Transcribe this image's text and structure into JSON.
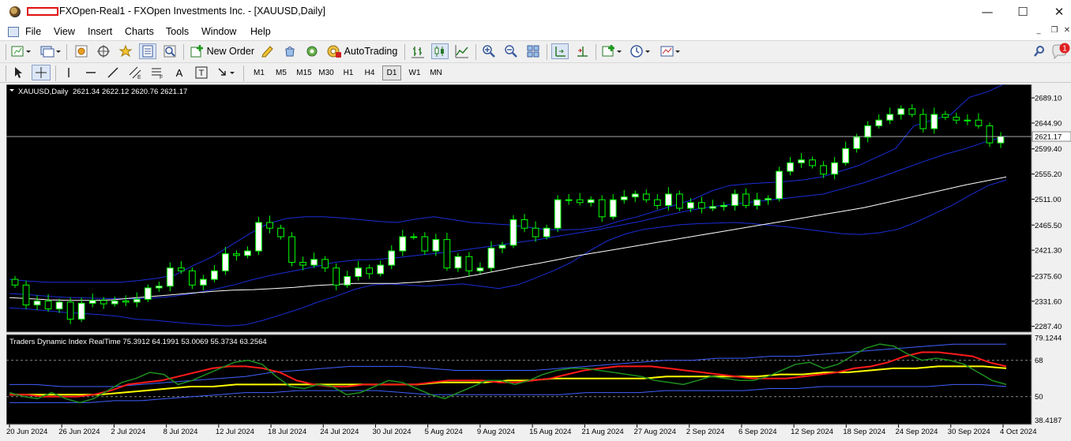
{
  "window": {
    "title": "FXOpen-Real1 - FXOpen Investments Inc. - [XAUUSD,Daily]",
    "minimize": "—",
    "maximize": "☐",
    "close": "✕"
  },
  "menu": {
    "items": [
      "File",
      "View",
      "Insert",
      "Charts",
      "Tools",
      "Window",
      "Help"
    ],
    "mdi_minimize": "_",
    "mdi_restore": "❐",
    "mdi_close": "✕"
  },
  "toolbar": {
    "new_order_label": "New Order",
    "autotrading_label": "AutoTrading",
    "notification_count": "1",
    "timeframes": [
      "M1",
      "M5",
      "M15",
      "M30",
      "H1",
      "H4",
      "D1",
      "W1",
      "MN"
    ],
    "active_timeframe": "D1",
    "text_tool": "A",
    "text_label_tool": "T"
  },
  "icons": {
    "toolbar1": [
      "new-chart-icon",
      "profiles-icon",
      "market-watch-icon",
      "navigator-icon",
      "favorites-icon",
      "data-window-icon",
      "strategy-tester-icon",
      "new-order-icon",
      "metaeditor-icon",
      "mql-market-icon",
      "signals-icon",
      "autotrading-icon",
      "bar-chart-icon",
      "candlesticks-icon",
      "line-chart-icon",
      "zoom-in-icon",
      "zoom-out-icon",
      "tile-windows-icon",
      "chart-shift-icon",
      "autoscroll-icon",
      "indicators-icon",
      "periods-icon",
      "templates-icon",
      "search-icon",
      "notification-icon"
    ],
    "toolbar2": [
      "cursor-icon",
      "crosshair-icon",
      "vertical-line-icon",
      "horizontal-line-icon",
      "trendline-icon",
      "equidistant-channel-icon",
      "fibonacci-icon",
      "text-icon",
      "text-label-icon",
      "arrows-icon"
    ]
  },
  "colors": {
    "chart_bg": "#000000",
    "bull_body": "#ffffff",
    "bear_body": "#000000",
    "wick": "#00ff00",
    "bollinger": "#1a2dd8",
    "ma": "#ffffff",
    "tdi_green": "#1e8e1e",
    "tdi_red": "#ff1a1a",
    "tdi_yellow": "#ffff00",
    "tdi_band": "#4060ff",
    "price_line": "#c0c0c0"
  },
  "chart_data": {
    "type": "candlestick",
    "symbol_label": "XAUUSD,Daily",
    "ohlc_label": "2621.34 2622.12 2620.76 2621.17",
    "current_price_label": "2621.17",
    "price_axis": [
      "2689.10",
      "2644.90",
      "2599.40",
      "2555.20",
      "2511.00",
      "2465.50",
      "2421.30",
      "2375.60",
      "2331.60",
      "2287.40"
    ],
    "ylim": [
      2280,
      2710
    ],
    "date_axis": [
      "20 Jun 2024",
      "26 Jun 2024",
      "2 Jul 2024",
      "8 Jul 2024",
      "12 Jul 2024",
      "18 Jul 2024",
      "24 Jul 2024",
      "30 Jul 2024",
      "5 Aug 2024",
      "9 Aug 2024",
      "15 Aug 2024",
      "21 Aug 2024",
      "27 Aug 2024",
      "2 Sep 2024",
      "6 Sep 2024",
      "12 Sep 2024",
      "18 Sep 2024",
      "24 Sep 2024",
      "30 Sep 2024",
      "4 Oct 2024"
    ],
    "closes": [
      2360,
      2325,
      2332,
      2318,
      2330,
      2300,
      2328,
      2333,
      2327,
      2332,
      2330,
      2335,
      2355,
      2358,
      2390,
      2385,
      2360,
      2370,
      2385,
      2415,
      2412,
      2420,
      2470,
      2460,
      2445,
      2400,
      2395,
      2405,
      2390,
      2360,
      2375,
      2390,
      2380,
      2395,
      2420,
      2445,
      2445,
      2420,
      2440,
      2390,
      2410,
      2385,
      2390,
      2425,
      2430,
      2475,
      2460,
      2445,
      2460,
      2510,
      2510,
      2505,
      2510,
      2480,
      2510,
      2515,
      2520,
      2510,
      2500,
      2520,
      2495,
      2505,
      2495,
      2498,
      2500,
      2520,
      2500,
      2510,
      2512,
      2560,
      2575,
      2580,
      2570,
      2555,
      2575,
      2600,
      2620,
      2640,
      2650,
      2660,
      2670,
      2660,
      2635,
      2660,
      2655,
      2650,
      2650,
      2640,
      2610,
      2621
    ],
    "bollinger_upper": [
      2370,
      2367,
      2365,
      2365,
      2365,
      2365,
      2365,
      2368,
      2372,
      2378,
      2395,
      2410,
      2430,
      2450,
      2468,
      2477,
      2480,
      2480,
      2478,
      2475,
      2472,
      2470,
      2476,
      2480,
      2475,
      2470,
      2468,
      2466,
      2462,
      2458,
      2457,
      2458,
      2462,
      2472,
      2480,
      2490,
      2500,
      2510,
      2525,
      2535,
      2538,
      2540,
      2542,
      2545,
      2550,
      2560,
      2570,
      2585,
      2600,
      2640,
      2650,
      2660,
      2690,
      2700,
      2715
    ],
    "bollinger_mid": [
      2345,
      2343,
      2340,
      2338,
      2337,
      2336,
      2336,
      2337,
      2340,
      2345,
      2352,
      2360,
      2370,
      2378,
      2385,
      2392,
      2400,
      2404,
      2405,
      2408,
      2412,
      2416,
      2420,
      2425,
      2430,
      2435,
      2440,
      2446,
      2452,
      2458,
      2465,
      2472,
      2480,
      2488,
      2495,
      2500,
      2504,
      2508,
      2512,
      2516,
      2520,
      2530,
      2540,
      2552,
      2565,
      2578,
      2590,
      2600,
      2612,
      2622
    ],
    "bollinger_lower": [
      2320,
      2318,
      2315,
      2312,
      2310,
      2308,
      2305,
      2300,
      2298,
      2295,
      2292,
      2290,
      2288,
      2290,
      2298,
      2308,
      2318,
      2330,
      2340,
      2352,
      2360,
      2362,
      2360,
      2358,
      2360,
      2362,
      2358,
      2354,
      2360,
      2372,
      2385,
      2400,
      2420,
      2438,
      2450,
      2458,
      2462,
      2466,
      2468,
      2469,
      2470,
      2468,
      2465,
      2462,
      2458,
      2454,
      2450,
      2449,
      2452,
      2458,
      2470,
      2485,
      2500,
      2518,
      2535,
      2545
    ],
    "moving_average": [
      2338,
      2336,
      2334,
      2333,
      2333,
      2334,
      2337,
      2340,
      2343,
      2346,
      2349,
      2351,
      2352,
      2354,
      2356,
      2359,
      2361,
      2363,
      2363,
      2363,
      2365,
      2368,
      2372,
      2378,
      2385,
      2392,
      2398,
      2405,
      2412,
      2418,
      2424,
      2430,
      2436,
      2442,
      2448,
      2454,
      2460,
      2466,
      2472,
      2478,
      2484,
      2490,
      2496,
      2504,
      2512,
      2520,
      2528,
      2536,
      2543,
      2550
    ],
    "tdi": {
      "label": "Traders Dynamic Index RealTime 75.3912 64.1991 53.0069 55.3734 63.2564",
      "axis": [
        "79.1244",
        "68",
        "50",
        "38.4187"
      ],
      "levels": [
        68,
        50
      ],
      "ylim": [
        37,
        80
      ],
      "green": [
        52,
        50,
        49,
        52,
        49,
        47,
        49,
        53,
        57,
        59,
        62,
        61,
        56,
        58,
        61,
        64,
        67,
        68,
        66,
        60,
        55,
        54,
        56,
        55,
        51,
        52,
        55,
        58,
        57,
        54,
        51,
        49,
        52,
        55,
        58,
        58,
        56,
        58,
        61,
        63,
        64,
        64,
        63,
        62,
        61,
        60,
        58,
        57,
        56,
        58,
        60,
        59,
        58,
        58,
        60,
        63,
        66,
        67,
        64,
        66,
        70,
        74,
        76,
        75,
        71,
        68,
        69,
        68,
        66,
        62,
        58,
        56
      ],
      "red": [
        51,
        51,
        50,
        50,
        50,
        51,
        53,
        56,
        57,
        58,
        60,
        62,
        64,
        65,
        65,
        64,
        62,
        58,
        56,
        55,
        55,
        56,
        56,
        56,
        56,
        57,
        58,
        58,
        58,
        57,
        57,
        58,
        59,
        61,
        63,
        64,
        65,
        65,
        65,
        64,
        63,
        62,
        61,
        60,
        59,
        59,
        59,
        60,
        61,
        62,
        64,
        65,
        67,
        70,
        72,
        72,
        71,
        70,
        67,
        65
      ],
      "yellow": [
        51,
        51,
        51,
        51,
        51,
        52,
        53,
        54,
        55,
        55,
        56,
        56,
        56,
        56,
        56,
        56,
        56,
        56,
        56,
        57,
        57,
        57,
        58,
        58,
        59,
        59,
        59,
        59,
        59,
        60,
        60,
        60,
        60,
        60,
        61,
        61,
        62,
        62,
        63,
        64,
        64,
        65,
        65,
        65,
        64
      ],
      "upper_band": [
        56,
        56,
        55,
        55,
        55,
        56,
        57,
        58,
        59,
        60,
        62,
        63,
        64,
        65,
        65,
        65,
        64,
        63,
        63,
        63,
        63,
        64,
        65,
        66,
        67,
        68,
        68,
        69,
        69,
        70,
        70,
        71,
        72,
        73,
        74,
        75,
        76,
        76,
        76
      ],
      "lower_band": [
        47,
        47,
        47,
        47,
        48,
        48,
        49,
        50,
        51,
        52,
        52,
        53,
        53,
        53,
        53,
        52,
        51,
        51,
        51,
        51,
        51,
        51,
        52,
        52,
        52,
        53,
        53,
        53,
        53,
        54,
        54,
        55,
        55,
        55,
        55,
        55,
        56,
        56,
        55
      ]
    }
  }
}
